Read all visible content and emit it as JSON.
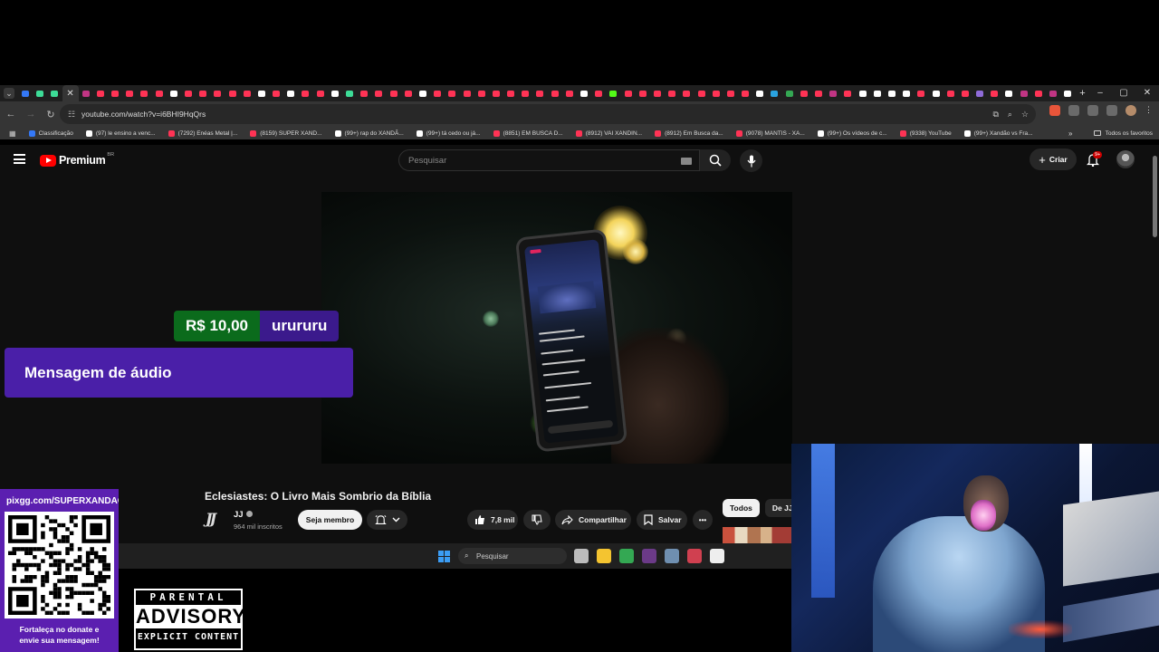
{
  "browser": {
    "url": "youtube.com/watch?v=i6BHI9HqQrs",
    "tab_colors": [
      "#3478f6",
      "#3ddc97",
      "#3ddc97",
      "#ff3355",
      "#c13584",
      "#ff3355",
      "#ff3355",
      "#ff3355",
      "#ff3355",
      "#ff3355",
      "#ffffff",
      "#ff3355",
      "#ff3355",
      "#ff3355",
      "#ff3355",
      "#ff3355",
      "#ffffff",
      "#ff3355",
      "#ffffff",
      "#ff3355",
      "#ff3355",
      "#ffffff",
      "#3ddc97",
      "#ff3355",
      "#ff3355",
      "#ff3355",
      "#ff3355",
      "#ffffff",
      "#ff3355",
      "#ff3355",
      "#ff3355",
      "#ff3355",
      "#ff3355",
      "#ff3355",
      "#ff3355",
      "#ff3355",
      "#ff3355",
      "#ff3355",
      "#ffffff",
      "#ff3355",
      "#53fc18",
      "#ff3355",
      "#ff3355",
      "#ff3355",
      "#ff3355",
      "#ff3355",
      "#ff3355",
      "#ff3355",
      "#ff3355",
      "#ff3355",
      "#ffffff",
      "#2aa3e0",
      "#34a853",
      "#ff3355",
      "#ff3355",
      "#c13584",
      "#ff3355",
      "#ffffff",
      "#ffffff",
      "#ffffff",
      "#ffffff",
      "#ff3355",
      "#ffffff",
      "#ff3355",
      "#ff3355",
      "#8f6bd8",
      "#ff3355",
      "#ffffff",
      "#c13584",
      "#ff3355",
      "#c13584",
      "#ffffff"
    ],
    "new_tab": "+",
    "window_controls": [
      "–",
      "▢",
      "✕"
    ],
    "bookmarks": [
      {
        "label": "Classificação",
        "color": "#3478f6"
      },
      {
        "label": "(97) le ensino a venc...",
        "color": "#ffffff"
      },
      {
        "label": "(7292) Enéas Metal |...",
        "color": "#ff3355"
      },
      {
        "label": "(8159) SUPER XAND...",
        "color": "#ff3355"
      },
      {
        "label": "(99+) rap do XANDÃ...",
        "color": "#ffffff"
      },
      {
        "label": "(99+) tá cedo ou já...",
        "color": "#ffffff"
      },
      {
        "label": "(8851) EM BUSCA D...",
        "color": "#ff3355"
      },
      {
        "label": "(8912) VAI XANDIN...",
        "color": "#ff3355"
      },
      {
        "label": "(8912) Em Busca da...",
        "color": "#ff3355"
      },
      {
        "label": "(9078) MANTIS - XA...",
        "color": "#ff3355"
      },
      {
        "label": "(99+) Os vídeos de c...",
        "color": "#ffffff"
      },
      {
        "label": "(9338) YouTube",
        "color": "#ff3355"
      },
      {
        "label": "(99+) Xandão vs Fra...",
        "color": "#ffffff"
      }
    ],
    "bookmarks_more": "»",
    "all_bookmarks": "Todos os favoritos"
  },
  "youtube": {
    "logo_text": "Premium",
    "country": "BR",
    "search_placeholder": "Pesquisar",
    "create_label": "Criar",
    "notifications_badge": "9+",
    "video_title": "Eclesiastes: O Livro Mais Sombrio da Bíblia",
    "channel_name": "JJ",
    "channel_logo": "JJ",
    "subscribers": "964 mil inscritos",
    "join_label": "Seja membro",
    "likes": "7,8 mil",
    "share_label": "Compartilhar",
    "save_label": "Salvar",
    "more_label": "•••",
    "chips": [
      "Todos",
      "De JJ"
    ]
  },
  "overlay": {
    "donation_amount": "R$ 10,00",
    "donation_user": "urururu",
    "audio_message": "Mensagem de áudio",
    "pix_url": "pixgg.com/SUPERXANDAO",
    "pix_footer_line1": "Fortaleça no donate e",
    "pix_footer_line2": "envie sua mensagem!",
    "advisory_top": "PARENTAL",
    "advisory_mid": "ADVISORY",
    "advisory_bottom": "EXPLICIT CONTENT"
  },
  "taskbar": {
    "search_placeholder": "Pesquisar",
    "icons": [
      {
        "name": "task-view-icon",
        "color": "#bbbbbb"
      },
      {
        "name": "file-explorer-icon",
        "color": "#f4c430"
      },
      {
        "name": "chrome-icon",
        "color": "#34a853"
      },
      {
        "name": "steam-icon",
        "color": "#6b3a88"
      },
      {
        "name": "settings-icon",
        "color": "#6f8fb0"
      },
      {
        "name": "app-icon",
        "color": "#d04050"
      },
      {
        "name": "document-icon",
        "color": "#eeeeee"
      }
    ]
  }
}
